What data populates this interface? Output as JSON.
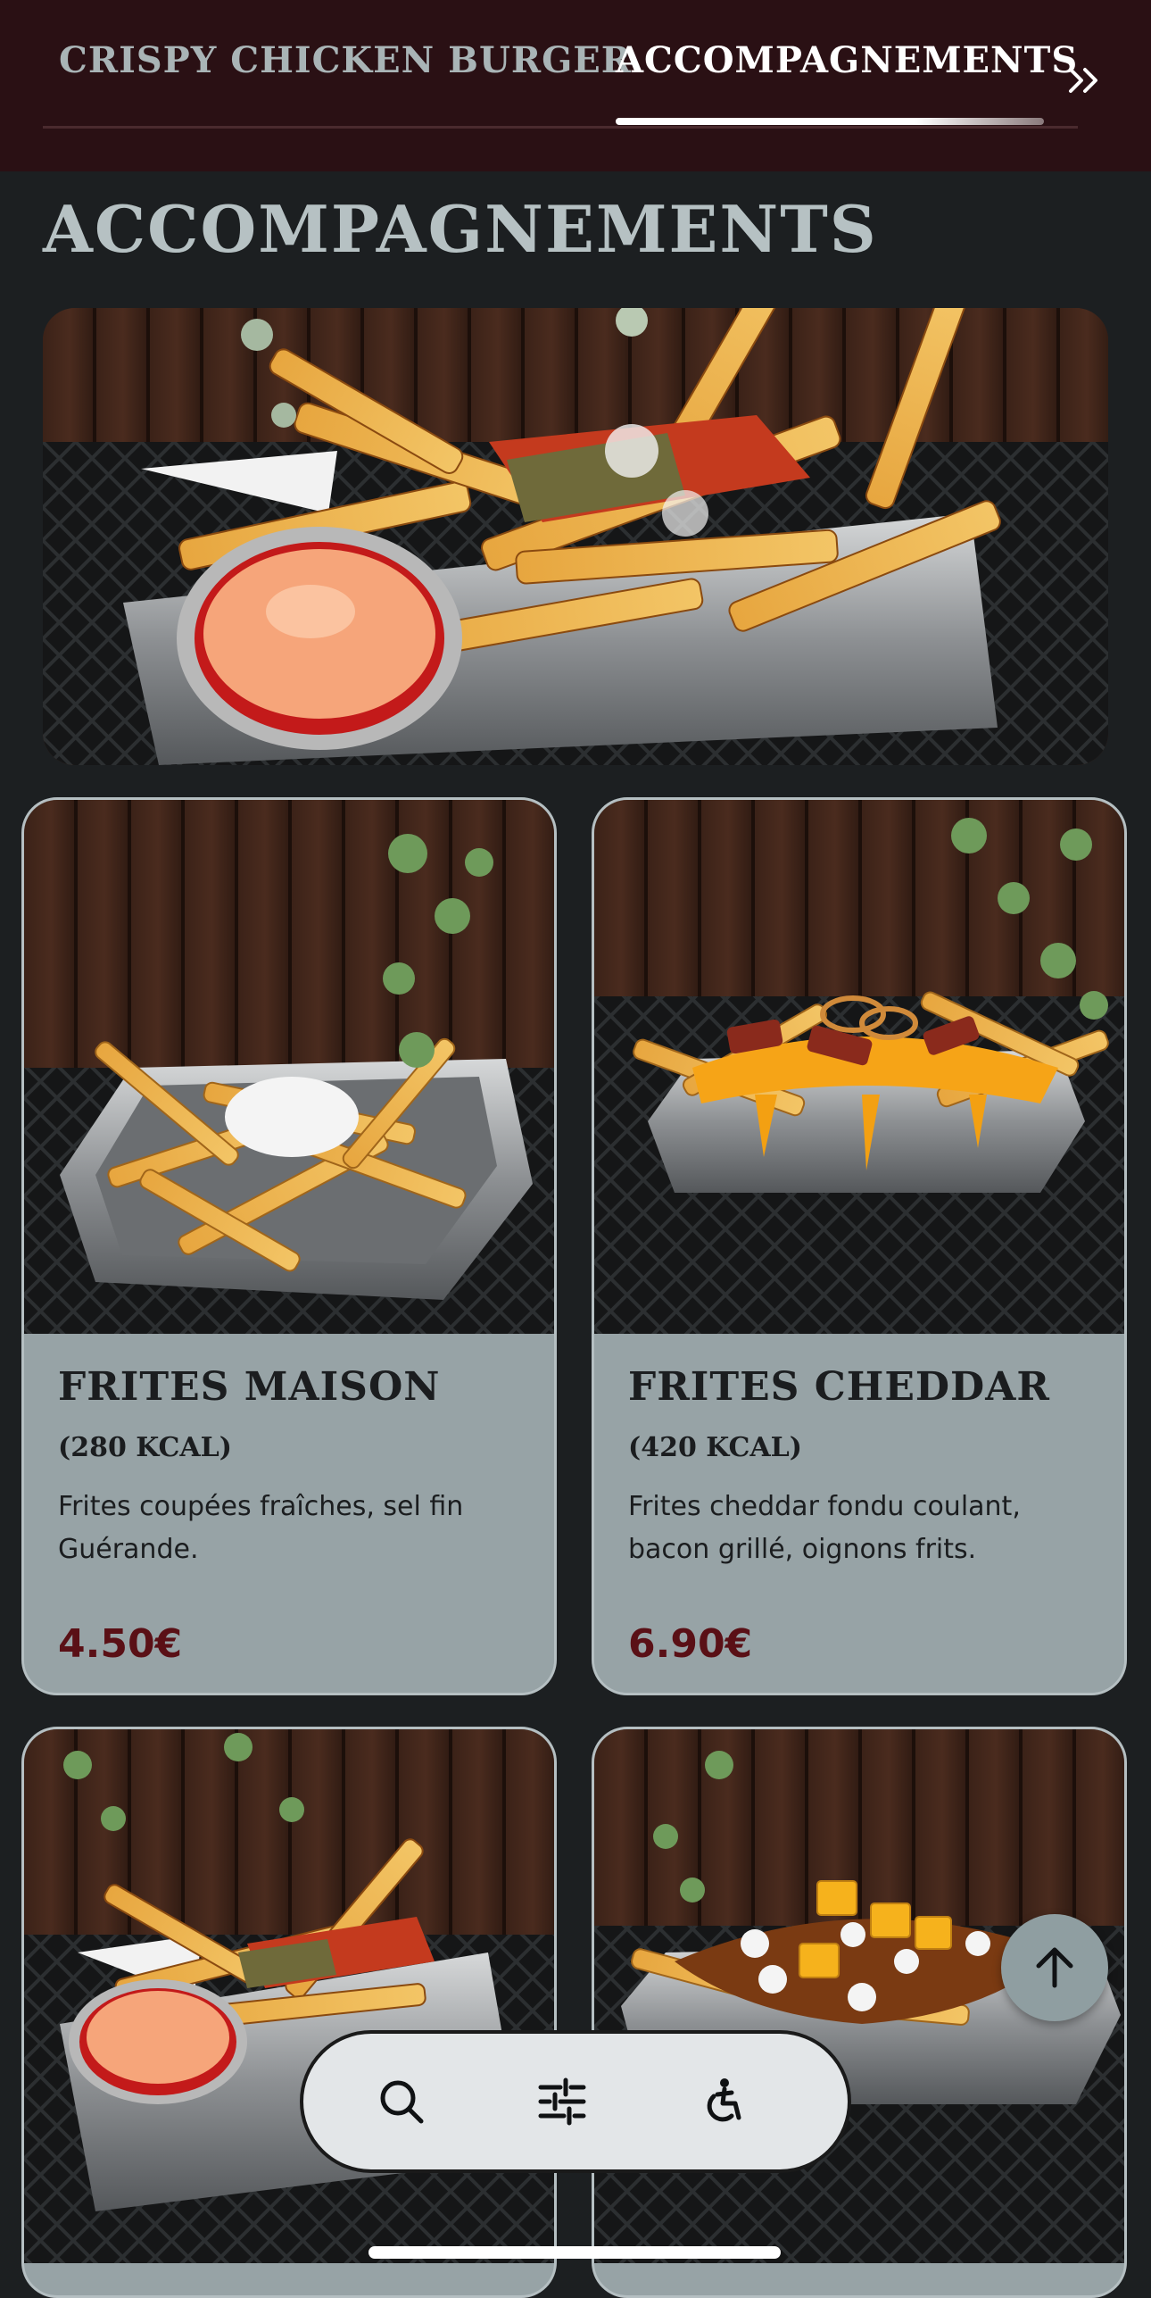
{
  "nav": {
    "tabs": [
      {
        "label": "CRISPY CHICKEN BURGER",
        "active": false
      },
      {
        "label": "ACCOMPAGNEMENTS",
        "active": true
      }
    ],
    "more_icon": "double-chevron-right-icon"
  },
  "section": {
    "title": "ACCOMPAGNEMENTS",
    "hero_image": "seasoned-fries-basket-photo"
  },
  "items": [
    {
      "name": "FRITES MAISON",
      "kcal": "(280 KCAL)",
      "description": "Frites coupées fraîches, sel fin Guérande.",
      "price": "4.50€",
      "image": "fries-with-salt-photo"
    },
    {
      "name": "FRITES CHEDDAR",
      "kcal": "(420 KCAL)",
      "description": "Frites cheddar fondu coulant, bacon grillé, oignons frits.",
      "price": "6.90€",
      "image": "cheddar-fries-photo"
    },
    {
      "image": "spiced-fries-with-sauce-photo"
    },
    {
      "image": "poutine-photo"
    }
  ],
  "toolbar": {
    "icons": [
      "search-icon",
      "filter-sliders-icon",
      "accessibility-icon"
    ]
  },
  "scroll_top_icon": "arrow-up-icon",
  "colors": {
    "header_bg": "#2a1014",
    "page_bg": "#1c1f21",
    "card_bg": "#97a3a6",
    "price": "#5a1016",
    "title": "#b6c1c3"
  }
}
